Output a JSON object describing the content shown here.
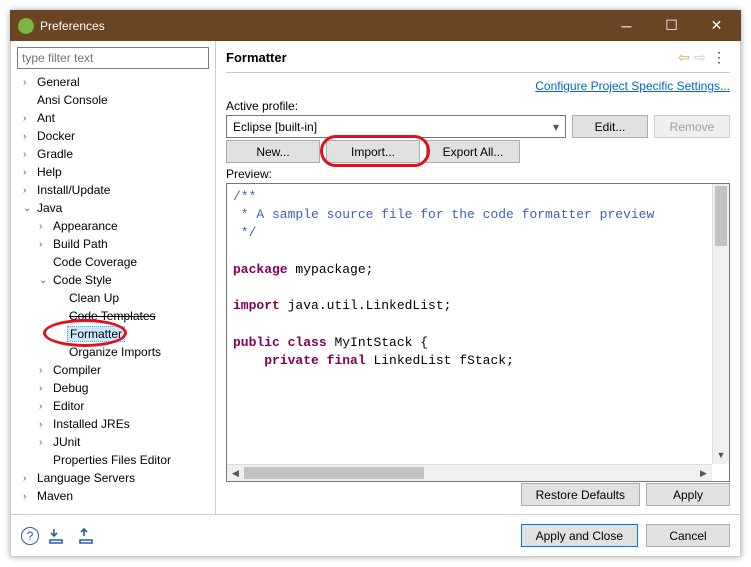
{
  "window": {
    "title": "Preferences"
  },
  "sidebar": {
    "filter_placeholder": "type filter text",
    "items": [
      {
        "label": "General",
        "depth": 0,
        "arrow": ">"
      },
      {
        "label": "Ansi Console",
        "depth": 0,
        "arrow": ""
      },
      {
        "label": "Ant",
        "depth": 0,
        "arrow": ">"
      },
      {
        "label": "Docker",
        "depth": 0,
        "arrow": ">"
      },
      {
        "label": "Gradle",
        "depth": 0,
        "arrow": ">"
      },
      {
        "label": "Help",
        "depth": 0,
        "arrow": ">"
      },
      {
        "label": "Install/Update",
        "depth": 0,
        "arrow": ">"
      },
      {
        "label": "Java",
        "depth": 0,
        "arrow": "v"
      },
      {
        "label": "Appearance",
        "depth": 1,
        "arrow": ">"
      },
      {
        "label": "Build Path",
        "depth": 1,
        "arrow": ">"
      },
      {
        "label": "Code Coverage",
        "depth": 1,
        "arrow": ""
      },
      {
        "label": "Code Style",
        "depth": 1,
        "arrow": "v"
      },
      {
        "label": "Clean Up",
        "depth": 2,
        "arrow": ""
      },
      {
        "label": "Code Templates",
        "depth": 2,
        "arrow": "",
        "strike": true
      },
      {
        "label": "Formatter",
        "depth": 2,
        "arrow": "",
        "selected": true,
        "annot": true
      },
      {
        "label": "Organize Imports",
        "depth": 2,
        "arrow": ""
      },
      {
        "label": "Compiler",
        "depth": 1,
        "arrow": ">"
      },
      {
        "label": "Debug",
        "depth": 1,
        "arrow": ">"
      },
      {
        "label": "Editor",
        "depth": 1,
        "arrow": ">"
      },
      {
        "label": "Installed JREs",
        "depth": 1,
        "arrow": ">"
      },
      {
        "label": "JUnit",
        "depth": 1,
        "arrow": ">"
      },
      {
        "label": "Properties Files Editor",
        "depth": 1,
        "arrow": ""
      },
      {
        "label": "Language Servers",
        "depth": 0,
        "arrow": ">"
      },
      {
        "label": "Maven",
        "depth": 0,
        "arrow": ">"
      }
    ]
  },
  "content": {
    "title": "Formatter",
    "config_link": "Configure Project Specific Settings...",
    "active_profile_label": "Active profile:",
    "active_profile_value": "Eclipse [built-in]",
    "buttons": {
      "edit": "Edit...",
      "remove": "Remove",
      "new": "New...",
      "import": "Import...",
      "export": "Export All..."
    },
    "preview_label": "Preview:",
    "preview_code": {
      "l1": "/**",
      "l2": " * A sample source file for the code formatter preview",
      "l3": " */",
      "l4": "",
      "kw_package": "package",
      "pkg": " mypackage;",
      "kw_import": "import",
      "imp": " java.util.LinkedList;",
      "kw_public": "public",
      "kw_class": "class",
      "cls": " MyIntStack {",
      "kw_private": "private",
      "kw_final": "final",
      "fld": " LinkedList fStack;"
    },
    "restore": "Restore Defaults",
    "apply": "Apply"
  },
  "footer": {
    "apply_close": "Apply and Close",
    "cancel": "Cancel"
  }
}
